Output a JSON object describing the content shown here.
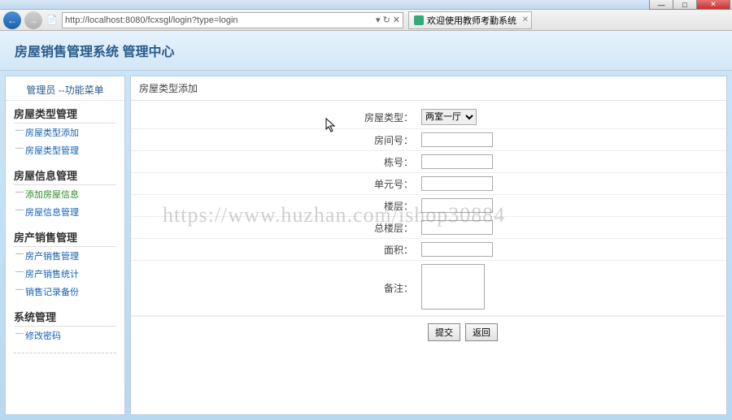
{
  "window": {
    "close": "✕",
    "min": "—",
    "max": "□"
  },
  "browser": {
    "url": "http://localhost:8080/fcxsgl/login?type=login",
    "tab_title": "欢迎使用教师考勤系统",
    "refresh": "↻",
    "stop": "✕"
  },
  "header": {
    "title": "房屋销售管理系统 管理中心"
  },
  "sidebar": {
    "title": "管理员 --功能菜单",
    "groups": [
      {
        "title": "房屋类型管理",
        "items": [
          {
            "label": "房屋类型添加",
            "active": false
          },
          {
            "label": "房屋类型管理",
            "active": false
          }
        ]
      },
      {
        "title": "房屋信息管理",
        "items": [
          {
            "label": "添加房屋信息",
            "active": true
          },
          {
            "label": "房屋信息管理",
            "active": false
          }
        ]
      },
      {
        "title": "房产销售管理",
        "items": [
          {
            "label": "房产销售管理",
            "active": false
          },
          {
            "label": "房产销售统计",
            "active": false
          },
          {
            "label": "销售记录备份",
            "active": false
          }
        ]
      },
      {
        "title": "系统管理",
        "items": [
          {
            "label": "修改密码",
            "active": false
          }
        ]
      }
    ]
  },
  "main": {
    "panel_title": "房屋类型添加",
    "fields": {
      "type_label": "房屋类型：",
      "type_value": "两室一厅",
      "room_label": "房间号：",
      "room_value": "",
      "building_label": "栋号：",
      "building_value": "",
      "unit_label": "单元号：",
      "unit_value": "",
      "floor_label": "楼层：",
      "floor_value": "",
      "total_floor_label": "总楼层：",
      "total_floor_value": "",
      "area_label": "面积：",
      "area_value": "",
      "remark_label": "备注：",
      "remark_value": ""
    },
    "buttons": {
      "submit": "提交",
      "back": "返回"
    }
  },
  "watermark": "https://www.huzhan.com/ishop30884"
}
